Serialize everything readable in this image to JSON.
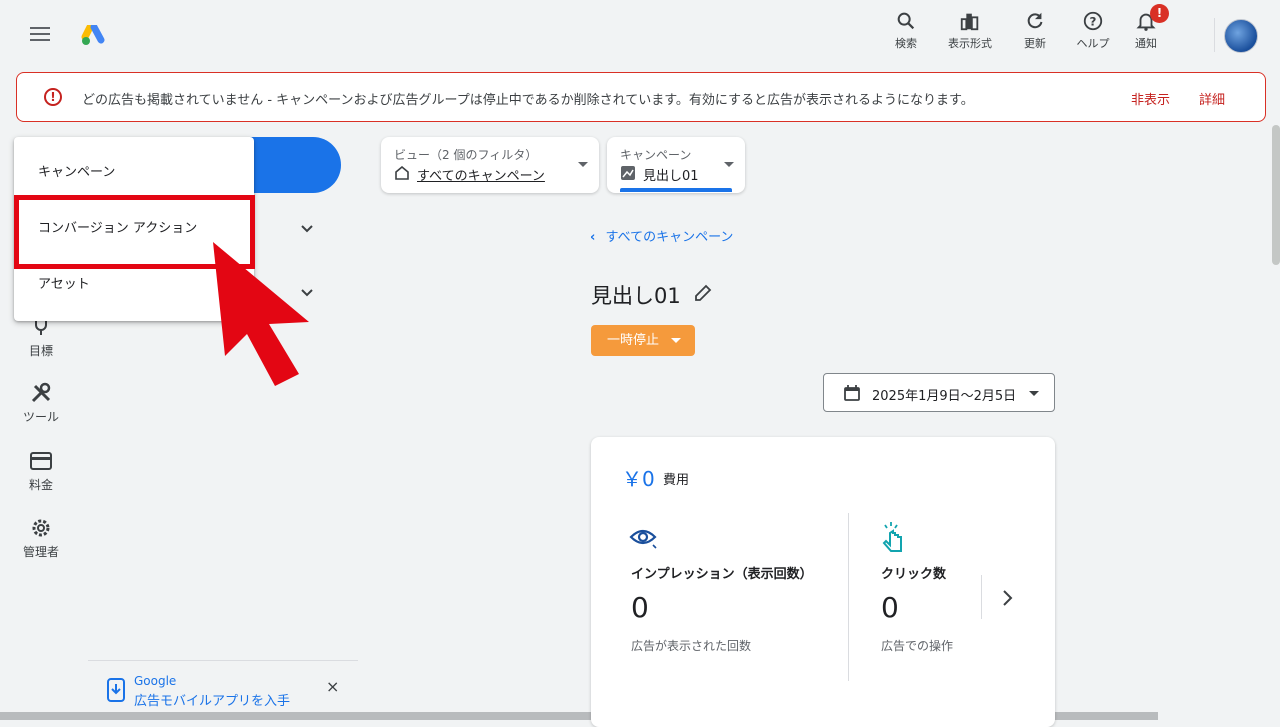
{
  "topbar": {
    "search_label": "検索",
    "view_label": "表示形式",
    "refresh_label": "更新",
    "help_label": "ヘルプ",
    "notifications_label": "通知",
    "notification_badge": "!"
  },
  "alert": {
    "icon": "!",
    "message": "どの広告も掲載されていません - キャンペーンおよび広告グループは停止中であるか削除されています。有効にすると広告が表示されるようになります。",
    "dismiss": "非表示",
    "details": "詳細"
  },
  "menu": {
    "items": [
      "キャンペーン",
      "コンバージョン アクション",
      "アセット"
    ]
  },
  "sidebar": {
    "goals": "目標",
    "tools": "ツール",
    "billing": "料金",
    "admin": "管理者"
  },
  "promo": {
    "brand": "Google",
    "text": "広告モバイルアプリを入手",
    "close": "×"
  },
  "filters": {
    "view_label": "ビュー（2 個のフィルタ）",
    "view_value": "すべてのキャンペーン",
    "campaign_label": "キャンペーン",
    "campaign_value": "見出し01"
  },
  "main": {
    "back_link": "すべてのキャンペーン",
    "campaign_title": "見出し01",
    "status": "一時停止",
    "date_range": "2025年1月9日～2月5日"
  },
  "card": {
    "cost_value": "￥0",
    "cost_label": "費用",
    "impressions_label": "インプレッション（表示回数）",
    "impressions_value": "0",
    "impressions_sub": "広告が表示された回数",
    "clicks_label": "クリック数",
    "clicks_value": "0",
    "clicks_sub": "広告での操作"
  },
  "colors": {
    "accent": "#1a73e8",
    "alert": "#d93025",
    "status_orange": "#f59a3c",
    "highlight_red": "#e30613"
  }
}
